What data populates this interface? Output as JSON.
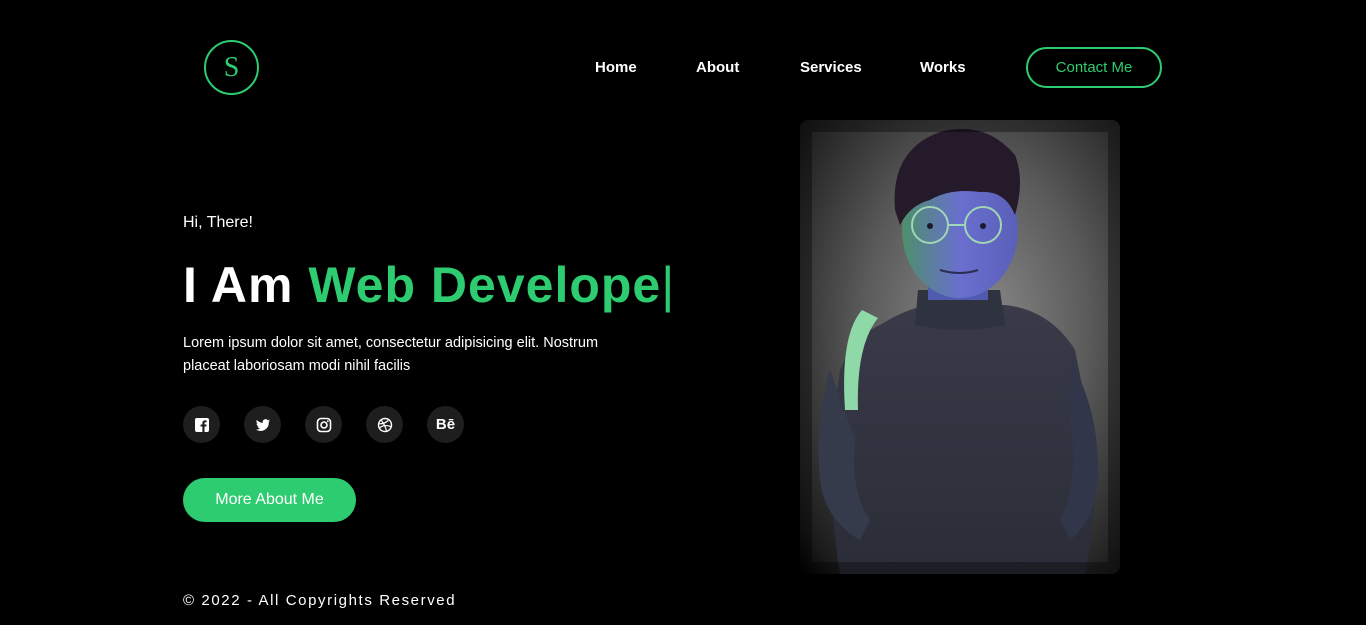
{
  "header": {
    "logo_letter": "S",
    "nav": [
      "Home",
      "About",
      "Services",
      "Works"
    ],
    "contact_label": "Contact Me"
  },
  "hero": {
    "greeting": "Hi, There!",
    "headline_prefix": "I Am ",
    "headline_highlight": "Web Develope",
    "headline_cursor": "|",
    "intro": "Lorem ipsum dolor sit amet, consectetur adipisicing elit. Nostrum placeat laboriosam modi nihil facilis",
    "socials": [
      "facebook-icon",
      "twitter-icon",
      "instagram-icon",
      "dribbble-icon",
      "behance-icon"
    ],
    "behance_text": "Bē",
    "more_label": "More About Me"
  },
  "footer": {
    "copyright": "© 2022 - All Copyrights Reserved"
  },
  "colors": {
    "accent": "#2ecc71",
    "background": "#000000",
    "social_bg": "#1e1e1e"
  }
}
